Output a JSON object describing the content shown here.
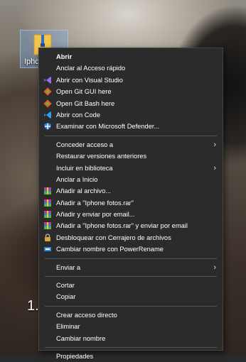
{
  "desktop": {
    "icon_label": "Ipho",
    "partial_text": "1."
  },
  "menu": {
    "group1": [
      {
        "label": "Abrir",
        "icon": "none",
        "bold": true
      },
      {
        "label": "Anclar al Acceso rápido",
        "icon": "none"
      },
      {
        "label": "Abrir con Visual Studio",
        "icon": "visual-studio-icon"
      },
      {
        "label": "Open Git GUI here",
        "icon": "git-icon"
      },
      {
        "label": "Open Git Bash here",
        "icon": "git-icon"
      },
      {
        "label": "Abrir con Code",
        "icon": "vscode-icon"
      },
      {
        "label": "Examinar con Microsoft Defender...",
        "icon": "defender-icon"
      }
    ],
    "group2": [
      {
        "label": "Conceder acceso a",
        "icon": "none",
        "submenu": true
      },
      {
        "label": "Restaurar versiones anteriores",
        "icon": "none"
      },
      {
        "label": "Incluir en biblioteca",
        "icon": "none",
        "submenu": true
      },
      {
        "label": "Anclar a Inicio",
        "icon": "none"
      },
      {
        "label": "Añadir al archivo...",
        "icon": "winrar-icon"
      },
      {
        "label": "Añadir a \"Iphone fotos.rar\"",
        "icon": "winrar-icon"
      },
      {
        "label": "Añadir y enviar por email...",
        "icon": "winrar-icon"
      },
      {
        "label": "Añadir a \"Iphone fotos.rar\" y enviar por email",
        "icon": "winrar-icon"
      },
      {
        "label": "Desbloquear con Cerrajero de archivos",
        "icon": "lock-icon"
      },
      {
        "label": "Cambiar nombre con PowerRename",
        "icon": "powerrename-icon"
      }
    ],
    "group3": [
      {
        "label": "Enviar a",
        "icon": "none",
        "submenu": true
      }
    ],
    "group4": [
      {
        "label": "Cortar",
        "icon": "none"
      },
      {
        "label": "Copiar",
        "icon": "none"
      }
    ],
    "group5": [
      {
        "label": "Crear acceso directo",
        "icon": "none"
      },
      {
        "label": "Eliminar",
        "icon": "none"
      },
      {
        "label": "Cambiar nombre",
        "icon": "none"
      }
    ],
    "group6": [
      {
        "label": "Propiedades",
        "icon": "none"
      }
    ],
    "submenu_arrow": "›"
  },
  "colors": {
    "menu_bg": "#2b2b2b",
    "menu_text": "#ffffff",
    "separator": "#555555"
  }
}
